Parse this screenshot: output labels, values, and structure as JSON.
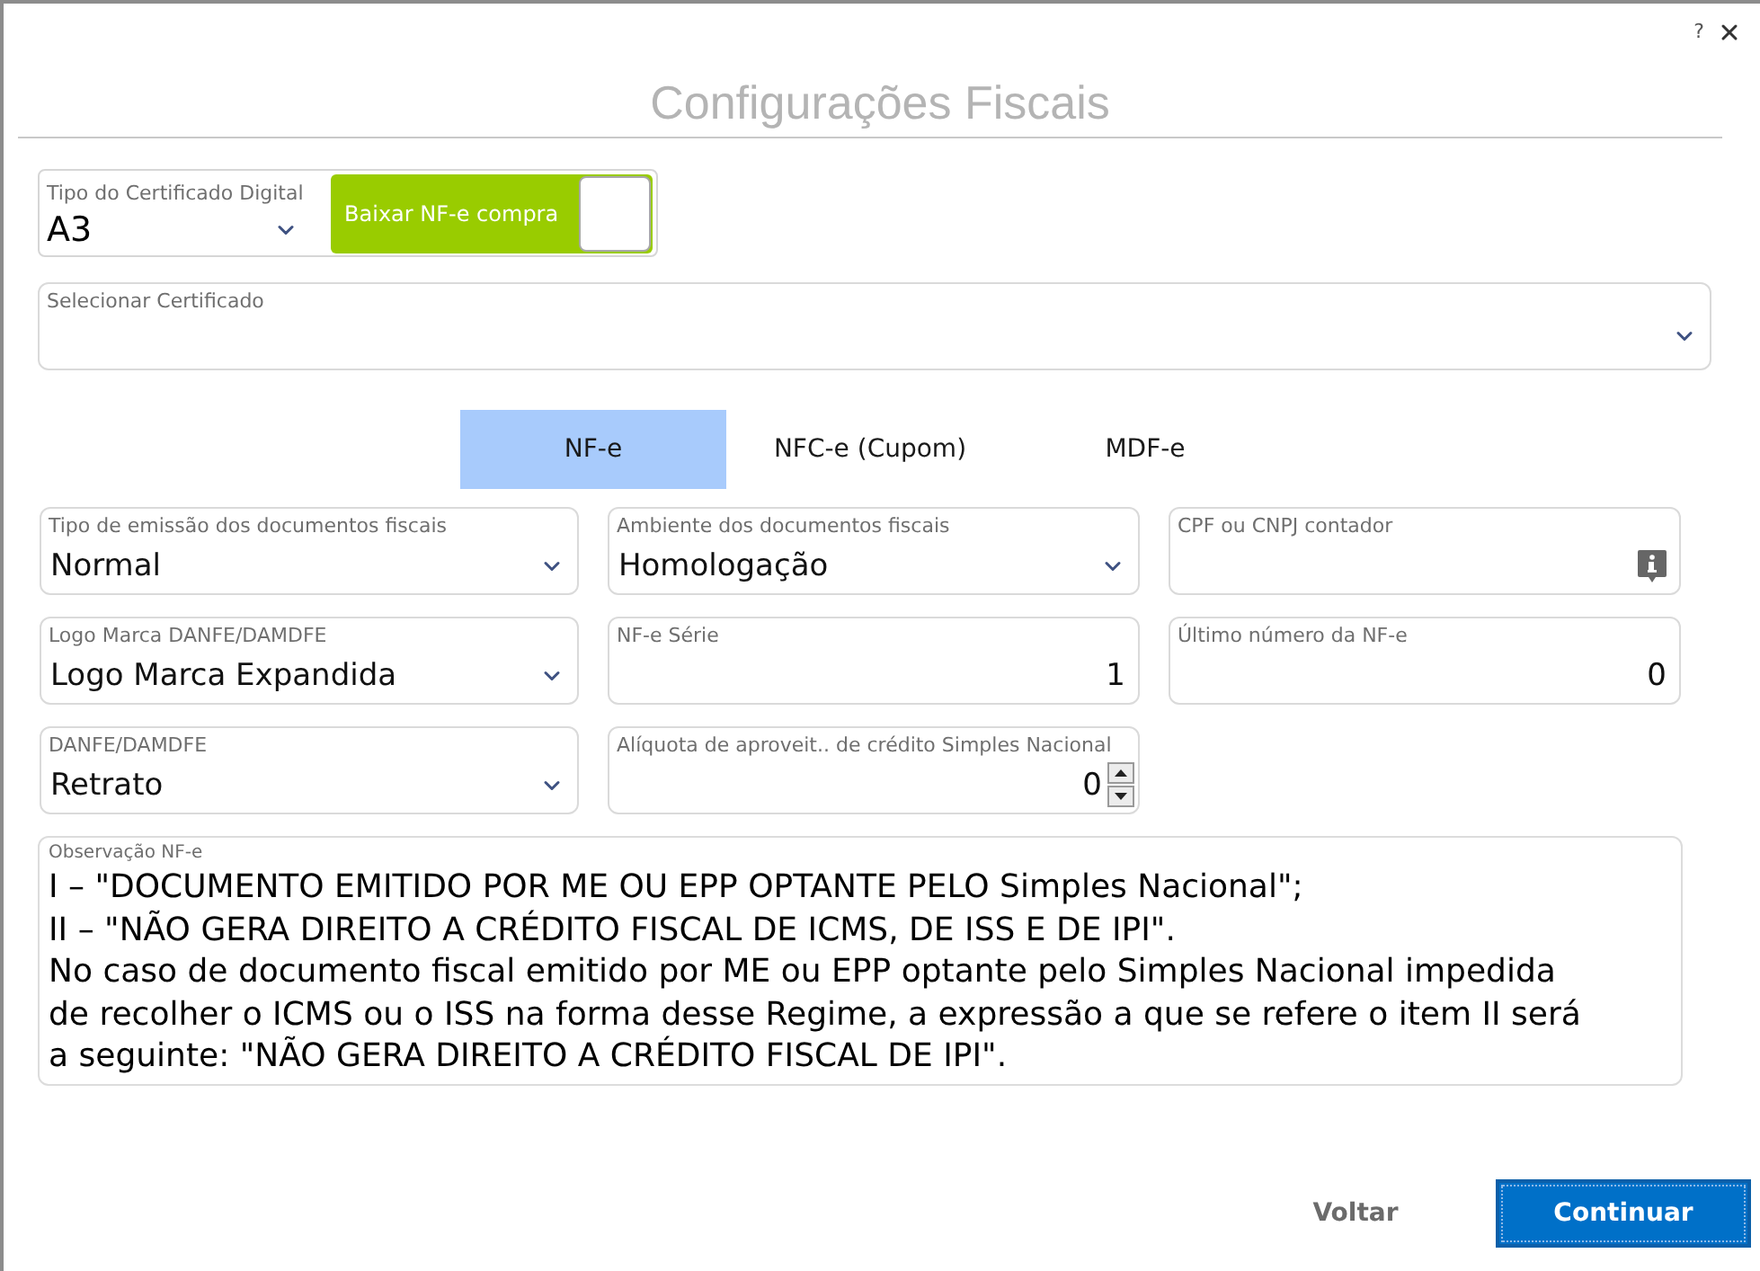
{
  "window": {
    "help": "?",
    "title": "Configurações Fiscais"
  },
  "certificate": {
    "type_field": {
      "label": "Tipo do Certificado Digital",
      "value": "A3"
    },
    "download_toggle": {
      "label": "Baixar NF-e compra",
      "on": true
    },
    "select_field": {
      "label": "Selecionar Certificado"
    }
  },
  "tabs": [
    {
      "label": "NF-e",
      "selected": true
    },
    {
      "label": "NFC-e (Cupom)",
      "selected": false
    },
    {
      "label": "MDF-e",
      "selected": false
    }
  ],
  "fields": [
    {
      "kind": "select",
      "label": "Tipo de emissão dos documentos fiscais",
      "value": "Normal"
    },
    {
      "kind": "select",
      "label": "Ambiente dos documentos fiscais",
      "value": "Homologação"
    },
    {
      "kind": "info_input",
      "label": "CPF ou CNPJ contador"
    },
    {
      "kind": "select",
      "label": "Logo Marca DANFE/DAMDFE",
      "value": "Logo Marca Expandida"
    },
    {
      "kind": "input",
      "label": "NF-e Série",
      "value": "1"
    },
    {
      "kind": "input",
      "label": "Último número da NF-e",
      "value": "0"
    },
    {
      "kind": "select",
      "label": "DANFE/DAMDFE",
      "value": "Retrato"
    },
    {
      "kind": "spin_input",
      "label": "Alíquota de aproveit.. de crédito Simples Nacional",
      "value": "0"
    }
  ],
  "observation": {
    "label": "Observação NF-e",
    "value": "I – \"DOCUMENTO EMITIDO POR ME OU EPP OPTANTE PELO Simples Nacional\";\nII – \"NÃO GERA DIREITO A CRÉDITO FISCAL DE ICMS, DE ISS E DE IPI\".\nNo caso de documento fiscal emitido por ME ou EPP optante pelo Simples Nacional impedida\nde recolher o ICMS ou o ISS na forma desse Regime, a expressão a que se refere o item II será\na seguinte: \"NÃO GERA DIREITO A CRÉDITO FISCAL DE IPI\"."
  },
  "buttons": [
    {
      "kind": "secondary",
      "label": "Voltar"
    },
    {
      "kind": "primary",
      "label": "Continuar"
    }
  ]
}
